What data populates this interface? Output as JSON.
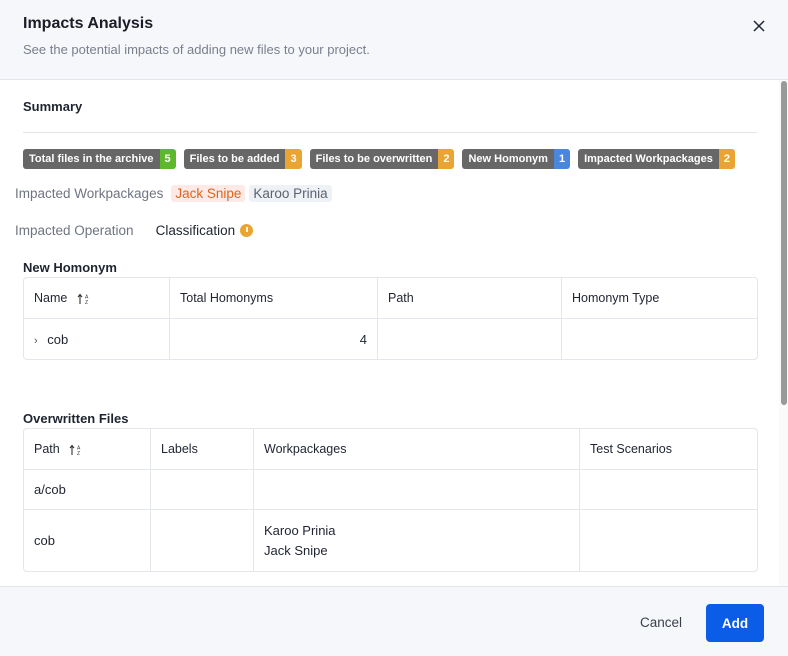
{
  "header": {
    "title": "Impacts Analysis",
    "subtitle": "See the potential impacts of adding new files to your project."
  },
  "summary": {
    "title": "Summary",
    "badges": [
      {
        "label": "Total files in the archive",
        "count": "5",
        "color": "#5fb72e"
      },
      {
        "label": "Files to be added",
        "count": "3",
        "color": "#eaa431"
      },
      {
        "label": "Files to be overwritten",
        "count": "2",
        "color": "#eaa431"
      },
      {
        "label": "New Homonym",
        "count": "1",
        "color": "#4a86dc"
      },
      {
        "label": "Impacted Workpackages",
        "count": "2",
        "color": "#eaa431"
      }
    ],
    "impacted_workpackages_label": "Impacted Workpackages",
    "impacted_workpackages": [
      "Jack Snipe",
      "Karoo Prinia"
    ],
    "impacted_operation_label": "Impacted Operation",
    "impacted_operation": "Classification"
  },
  "new_homonym": {
    "title": "New Homonym",
    "columns": [
      "Name",
      "Total Homonyms",
      "Path",
      "Homonym Type"
    ],
    "rows": [
      {
        "name": "cob",
        "total": "4",
        "path": "",
        "type": ""
      }
    ]
  },
  "overwritten_files": {
    "title": "Overwritten Files",
    "columns": [
      "Path",
      "Labels",
      "Workpackages",
      "Test Scenarios"
    ],
    "rows": [
      {
        "path": "a/cob",
        "labels": "",
        "workpackages": [
          "",
          ""
        ],
        "scenarios": ""
      },
      {
        "path": "cob",
        "labels": "",
        "workpackages": [
          "Karoo Prinia",
          "Jack Snipe"
        ],
        "scenarios": ""
      }
    ]
  },
  "footer": {
    "cancel_label": "Cancel",
    "add_label": "Add"
  }
}
